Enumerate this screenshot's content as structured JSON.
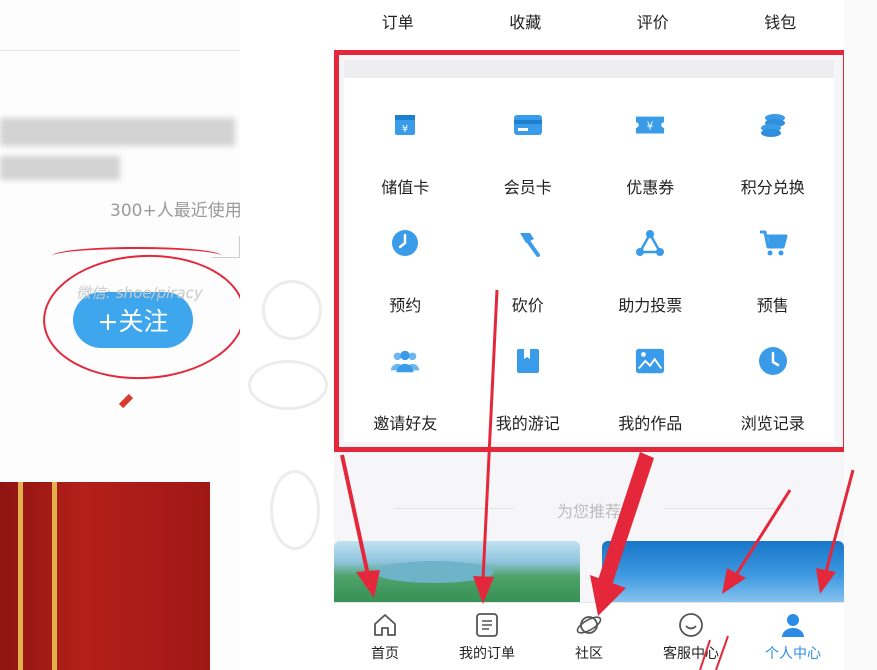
{
  "left": {
    "usage_text": "300+人最近使用",
    "watermark": "微信: shoe/piracy",
    "follow_button": "+关注"
  },
  "top_tabs": [
    "订单",
    "收藏",
    "评价",
    "钱包"
  ],
  "grid": [
    {
      "label": "储值卡",
      "icon": "stored-value-card-icon"
    },
    {
      "label": "会员卡",
      "icon": "member-card-icon"
    },
    {
      "label": "优惠券",
      "icon": "coupon-icon"
    },
    {
      "label": "积分兑换",
      "icon": "points-coins-icon"
    },
    {
      "label": "预约",
      "icon": "clock-icon"
    },
    {
      "label": "砍价",
      "icon": "axe-icon"
    },
    {
      "label": "助力投票",
      "icon": "share-nodes-icon"
    },
    {
      "label": "预售",
      "icon": "cart-icon"
    },
    {
      "label": "邀请好友",
      "icon": "users-icon"
    },
    {
      "label": "我的游记",
      "icon": "journal-icon"
    },
    {
      "label": "我的作品",
      "icon": "picture-icon"
    },
    {
      "label": "浏览记录",
      "icon": "history-clock-icon"
    }
  ],
  "recommend_title": "为您推荐",
  "bottom_nav": [
    {
      "label": "首页",
      "icon": "home-icon",
      "active": false
    },
    {
      "label": "我的订单",
      "icon": "order-list-icon",
      "active": false
    },
    {
      "label": "社区",
      "icon": "planet-icon",
      "active": false
    },
    {
      "label": "客服中心",
      "icon": "smile-chat-icon",
      "active": false
    },
    {
      "label": "个人中心",
      "icon": "user-icon",
      "active": true
    }
  ],
  "colors": {
    "accent": "#3ea6ec",
    "icon_blue": "#3a9be8",
    "annotation_red": "#e4273b",
    "active_nav": "#2b8ce8"
  }
}
